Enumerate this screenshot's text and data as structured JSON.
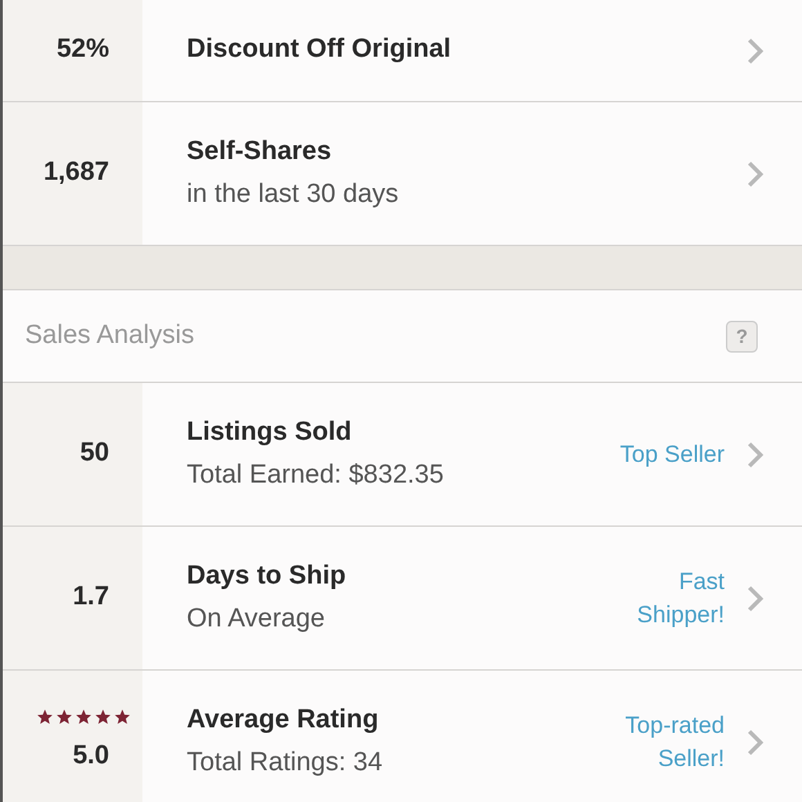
{
  "top_rows": [
    {
      "value": "52%",
      "title": "Discount Off Original"
    },
    {
      "value": "1,687",
      "title": "Self-Shares",
      "subtitle": "in the last 30 days"
    }
  ],
  "sales_analysis": {
    "heading": "Sales Analysis",
    "help": "?",
    "rows": [
      {
        "value": "50",
        "title": "Listings Sold",
        "subtitle": "Total Earned: $832.35",
        "badge": "Top Seller"
      },
      {
        "value": "1.7",
        "title": "Days to Ship",
        "subtitle": "On Average",
        "badge": "Fast Shipper!"
      },
      {
        "value": "5.0",
        "stars": 5,
        "title": "Average Rating",
        "subtitle": "Total Ratings: 34",
        "badge": "Top-rated Seller!"
      }
    ]
  }
}
